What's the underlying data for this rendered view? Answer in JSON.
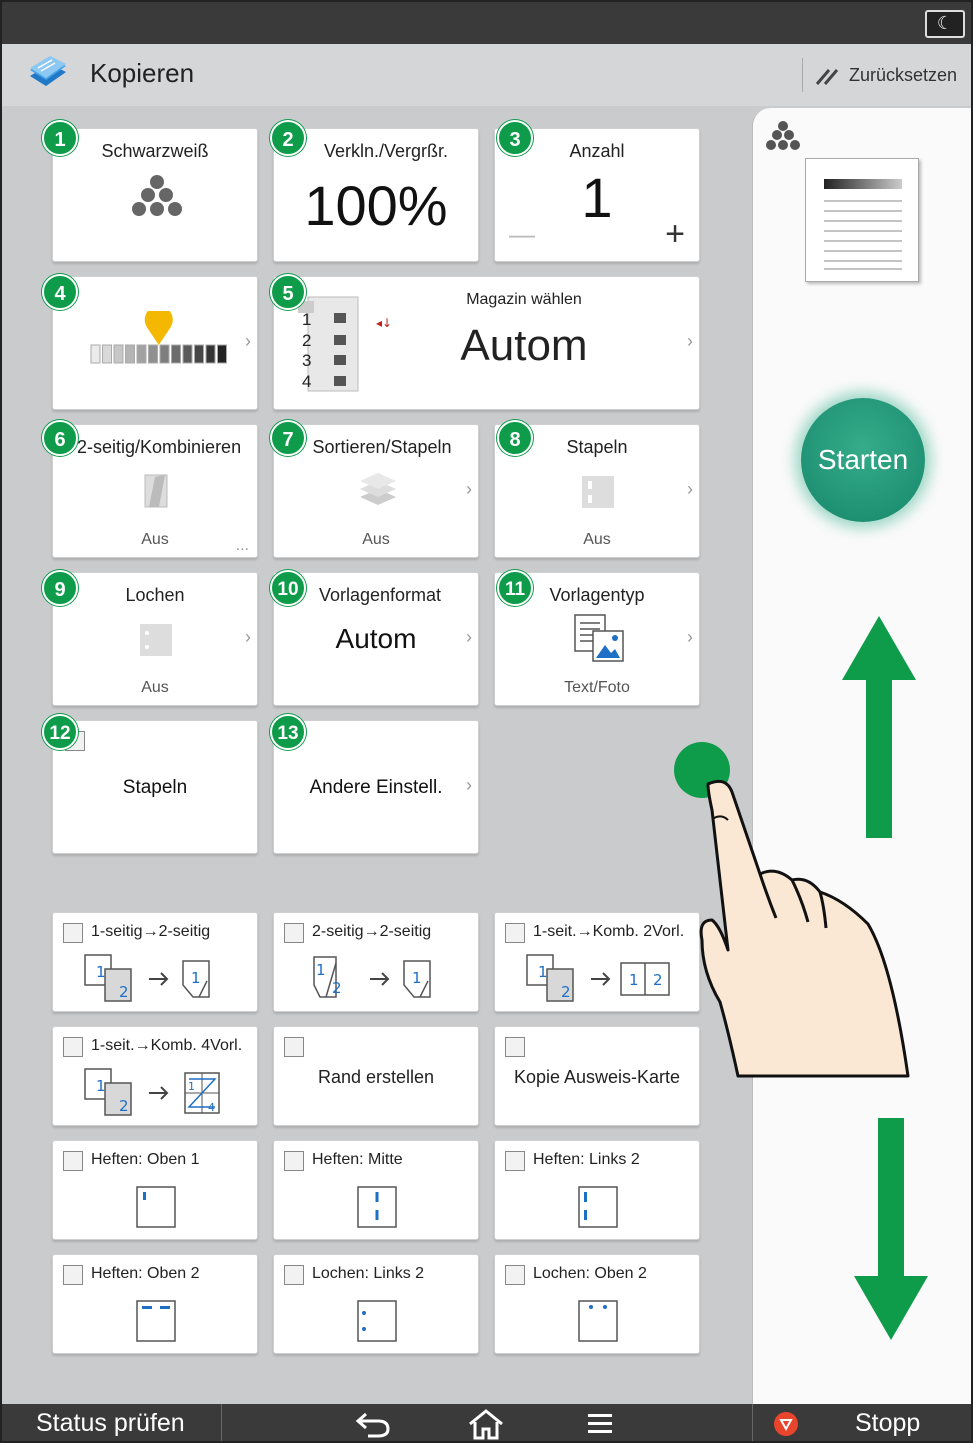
{
  "header": {
    "app_title": "Kopieren",
    "reset_label": "Zurücksetzen",
    "night_mode_icon": "moon-icon",
    "app_icon": "copy-stack-icon"
  },
  "tiles": {
    "t1": {
      "badge": "1",
      "title": "Schwarzweiß",
      "icon": "color-dots-icon"
    },
    "t2": {
      "badge": "2",
      "title": "Verkln./Vergrßr.",
      "value": "100%"
    },
    "t3": {
      "badge": "3",
      "title": "Anzahl",
      "value": "1",
      "minus": "—",
      "plus": "+"
    },
    "t4": {
      "badge": "4",
      "icon": "density-slider-icon",
      "level": 0.5
    },
    "t5": {
      "badge": "5",
      "title": "Magazin wählen",
      "value": "Autom",
      "trays": [
        "1",
        "2",
        "3",
        "4"
      ]
    },
    "t6": {
      "badge": "6",
      "title": "2-seitig/Kombinieren",
      "sub": "Aus",
      "more": "..."
    },
    "t7": {
      "badge": "7",
      "title": "Sortieren/Stapeln",
      "sub": "Aus"
    },
    "t8": {
      "badge": "8",
      "title": "Stapeln",
      "sub": "Aus"
    },
    "t9": {
      "badge": "9",
      "title": "Lochen",
      "sub": "Aus"
    },
    "t10": {
      "badge": "10",
      "title": "Vorlagenformat",
      "value": "Autom"
    },
    "t11": {
      "badge": "11",
      "title": "Vorlagentyp",
      "sub": "Text/Foto"
    },
    "t12": {
      "badge": "12",
      "title": "Stapeln"
    },
    "t13": {
      "badge": "13",
      "title": "Andere Einstell."
    }
  },
  "shortcuts": [
    {
      "label": "1-seitig→2-seitig"
    },
    {
      "label": "2-seitig→2-seitig"
    },
    {
      "label": "1-seit.→Komb. 2Vorl."
    },
    {
      "label": "1-seit.→Komb. 4Vorl."
    },
    {
      "label": "Rand erstellen"
    },
    {
      "label": "Kopie Ausweis-Karte"
    },
    {
      "label": "Heften: Oben 1"
    },
    {
      "label": "Heften: Mitte"
    },
    {
      "label": "Heften: Links 2"
    },
    {
      "label": "Heften: Oben 2"
    },
    {
      "label": "Lochen: Links 2"
    },
    {
      "label": "Lochen: Oben 2"
    }
  ],
  "diagram_digits": {
    "one": "1",
    "two": "2",
    "four": "4"
  },
  "side": {
    "start_label": "Starten"
  },
  "bottom": {
    "status_label": "Status prüfen",
    "stop_label": "Stopp"
  },
  "colors": {
    "badge": "#0e9b4a",
    "start": "#1d8f70",
    "arrow": "#0e9b4a",
    "stop": "#e8452c"
  }
}
